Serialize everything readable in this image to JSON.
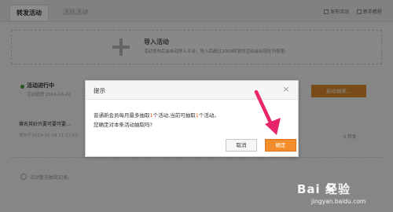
{
  "tabs": [
    {
      "label": "转发活动",
      "active": true
    },
    {
      "label": "活跃活动",
      "active": false
    }
  ],
  "top_links": {
    "publish": "发布活动",
    "tutorial": "新手教程"
  },
  "import_box": {
    "title": "导入活动",
    "description": "活动发布后会自动导入平台，导入后超过2000转发的活动会出现在列表里。"
  },
  "activity": {
    "status": "活动进行中",
    "meta": "活动管理 2014-10-22",
    "draw_button": "启动抽奖...",
    "name": "赛名其妙只要可要可要...",
    "date": "发布于2014-10-28 11:17:50",
    "count": "0 转发"
  },
  "empty_text": "活动暂无抽奖记录。",
  "dialog": {
    "title": "提示",
    "close": "×",
    "line1_parts": [
      "普通新会员每月最多抽取",
      "1",
      "个活动,当前可抽取",
      "1",
      "个活动。"
    ],
    "line2": "您确定对本条活动抽取吗?",
    "cancel": "取消",
    "confirm": "确定"
  },
  "watermark": {
    "brand": "Bai  经验",
    "url": "jingyan.baidu.com"
  },
  "colors": {
    "accent_orange": "#f48d2c",
    "highlight_red": "#e05a1a",
    "arrow_pink": "#e8256b"
  }
}
